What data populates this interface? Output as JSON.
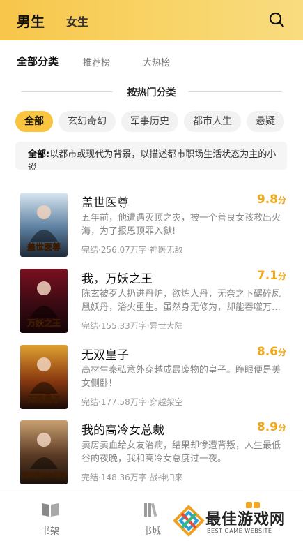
{
  "header": {
    "gender_tabs": [
      "男生",
      "女生"
    ],
    "search_icon": "search-icon"
  },
  "subtabs": [
    "全部分类",
    "推荐榜",
    "大热榜"
  ],
  "hot_section_title": "按热门分类",
  "categories": [
    "全部",
    "玄幻奇幻",
    "军事历史",
    "都市人生",
    "悬疑"
  ],
  "category_desc": {
    "label": "全部:",
    "text": "以都市或现代为背景，以描述都市职场生活状态为主的小说"
  },
  "books": [
    {
      "title": "盖世医尊",
      "score": "9.8",
      "score_unit": "分",
      "desc": "五年前，他遭遇灭顶之灾，被一个善良女孩救出火海，为了报恩顶罪入狱!",
      "meta": "完结·256.07万字·神医无敌",
      "cover_text": "盖世医尊",
      "cover_colors": [
        "#d8e6f0",
        "#5b7fa0",
        "#1e2a38"
      ]
    },
    {
      "title": "我，万妖之王",
      "score": "7.1",
      "score_unit": "分",
      "desc": "陈玄被歹人扔进丹炉，欲炼人丹，无奈之下碾碎凤凰妖丹，浴火重生。虽然身无修为，却能吞噬万物。",
      "meta": "完结·155.33万字·异世大陆",
      "cover_text": "万妖之王",
      "cover_colors": [
        "#7a1020",
        "#3a0a12",
        "#140406"
      ]
    },
    {
      "title": "无双皇子",
      "score": "8.6",
      "score_unit": "分",
      "desc": "高材生秦弘意外穿越成最废物的皇子。睁眼便是美女侧卧!",
      "meta": "完结·177.58万字·穿越架空",
      "cover_text": "无双皇子",
      "cover_colors": [
        "#e0a030",
        "#8a3a10",
        "#1a0a06"
      ]
    },
    {
      "title": "我的高冷女总裁",
      "score": "8.9",
      "score_unit": "分",
      "desc": "卖房卖血给女友治病，结果却惨遭背叛，人生最低谷的夜晚，我和高冷女总度过一夜。",
      "meta": "完结·148.36万字·战神归来",
      "cover_text": "我的高冷女总裁",
      "cover_colors": [
        "#c9a070",
        "#5a3a24",
        "#1a100a"
      ]
    }
  ],
  "bottom_nav": [
    {
      "label": "书架",
      "icon": "bookshelf-icon"
    },
    {
      "label": "书城",
      "icon": "bookstore-icon"
    },
    {
      "label": "",
      "icon": "category-icon"
    }
  ],
  "watermark": {
    "title": "最佳游戏网",
    "subtitle": "BEST GAME WEBSITE"
  },
  "colors": {
    "accent": "#f9c440",
    "score": "#f0a818",
    "header_start": "#f7c64a"
  }
}
